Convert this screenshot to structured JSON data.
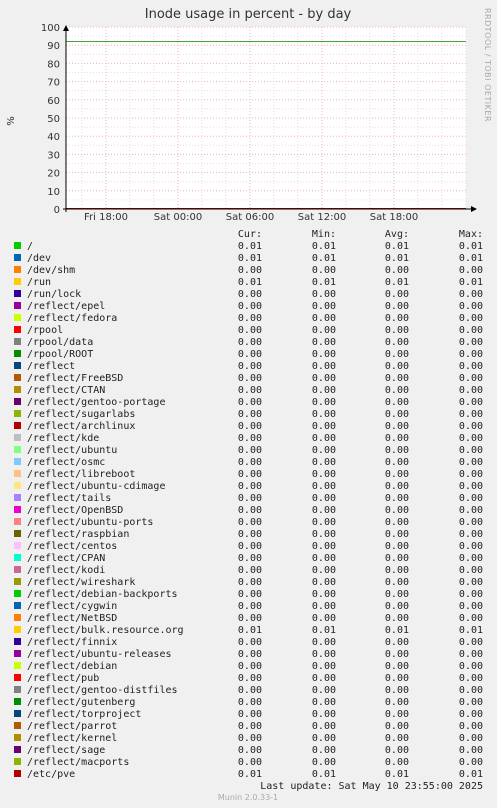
{
  "chart_data": {
    "type": "line",
    "title": "Inode usage in percent - by day",
    "ylabel": "%",
    "xlabel": "",
    "ylim": [
      0,
      100
    ],
    "y_ticks": [
      0,
      10,
      20,
      30,
      40,
      50,
      60,
      70,
      80,
      90,
      100
    ],
    "x_tick_labels": [
      "Fri 18:00",
      "Sat 00:00",
      "Sat 06:00",
      "Sat 12:00",
      "Sat 18:00"
    ],
    "threshold": {
      "value": 92,
      "color": "#4aa63a"
    },
    "grid": true,
    "legend_headers": [
      "Cur:",
      "Min:",
      "Avg:",
      "Max:"
    ],
    "series": [
      {
        "name": "/",
        "color": "#00cc00",
        "values": [
          "0.01",
          "0.01",
          "0.01",
          "0.01"
        ]
      },
      {
        "name": "/dev",
        "color": "#0066b3",
        "values": [
          "0.01",
          "0.01",
          "0.01",
          "0.01"
        ]
      },
      {
        "name": "/dev/shm",
        "color": "#ff8000",
        "values": [
          "0.00",
          "0.00",
          "0.00",
          "0.00"
        ]
      },
      {
        "name": "/run",
        "color": "#ffcc00",
        "values": [
          "0.01",
          "0.01",
          "0.01",
          "0.01"
        ]
      },
      {
        "name": "/run/lock",
        "color": "#330099",
        "values": [
          "0.00",
          "0.00",
          "0.00",
          "0.00"
        ]
      },
      {
        "name": "/reflect/epel",
        "color": "#990099",
        "values": [
          "0.00",
          "0.00",
          "0.00",
          "0.00"
        ]
      },
      {
        "name": "/reflect/fedora",
        "color": "#ccff00",
        "values": [
          "0.00",
          "0.00",
          "0.00",
          "0.00"
        ]
      },
      {
        "name": "/rpool",
        "color": "#ff0000",
        "values": [
          "0.00",
          "0.00",
          "0.00",
          "0.00"
        ]
      },
      {
        "name": "/rpool/data",
        "color": "#808080",
        "values": [
          "0.00",
          "0.00",
          "0.00",
          "0.00"
        ]
      },
      {
        "name": "/rpool/ROOT",
        "color": "#008f00",
        "values": [
          "0.00",
          "0.00",
          "0.00",
          "0.00"
        ]
      },
      {
        "name": "/reflect",
        "color": "#00487d",
        "values": [
          "0.00",
          "0.00",
          "0.00",
          "0.00"
        ]
      },
      {
        "name": "/reflect/FreeBSD",
        "color": "#b35a00",
        "values": [
          "0.00",
          "0.00",
          "0.00",
          "0.00"
        ]
      },
      {
        "name": "/reflect/CTAN",
        "color": "#b38f00",
        "values": [
          "0.00",
          "0.00",
          "0.00",
          "0.00"
        ]
      },
      {
        "name": "/reflect/gentoo-portage",
        "color": "#6b006b",
        "values": [
          "0.00",
          "0.00",
          "0.00",
          "0.00"
        ]
      },
      {
        "name": "/reflect/sugarlabs",
        "color": "#8fb300",
        "values": [
          "0.00",
          "0.00",
          "0.00",
          "0.00"
        ]
      },
      {
        "name": "/reflect/archlinux",
        "color": "#b30000",
        "values": [
          "0.00",
          "0.00",
          "0.00",
          "0.00"
        ]
      },
      {
        "name": "/reflect/kde",
        "color": "#bebebe",
        "values": [
          "0.00",
          "0.00",
          "0.00",
          "0.00"
        ]
      },
      {
        "name": "/reflect/ubuntu",
        "color": "#80ff80",
        "values": [
          "0.00",
          "0.00",
          "0.00",
          "0.00"
        ]
      },
      {
        "name": "/reflect/osmc",
        "color": "#80c9ff",
        "values": [
          "0.00",
          "0.00",
          "0.00",
          "0.00"
        ]
      },
      {
        "name": "/reflect/libreboot",
        "color": "#ffc080",
        "values": [
          "0.00",
          "0.00",
          "0.00",
          "0.00"
        ]
      },
      {
        "name": "/reflect/ubuntu-cdimage",
        "color": "#ffe680",
        "values": [
          "0.00",
          "0.00",
          "0.00",
          "0.00"
        ]
      },
      {
        "name": "/reflect/tails",
        "color": "#aa80ff",
        "values": [
          "0.00",
          "0.00",
          "0.00",
          "0.00"
        ]
      },
      {
        "name": "/reflect/OpenBSD",
        "color": "#ee00cc",
        "values": [
          "0.00",
          "0.00",
          "0.00",
          "0.00"
        ]
      },
      {
        "name": "/reflect/ubuntu-ports",
        "color": "#ff8080",
        "values": [
          "0.00",
          "0.00",
          "0.00",
          "0.00"
        ]
      },
      {
        "name": "/reflect/raspbian",
        "color": "#666600",
        "values": [
          "0.00",
          "0.00",
          "0.00",
          "0.00"
        ]
      },
      {
        "name": "/reflect/centos",
        "color": "#ffbfff",
        "values": [
          "0.00",
          "0.00",
          "0.00",
          "0.00"
        ]
      },
      {
        "name": "/reflect/CPAN",
        "color": "#00ffcc",
        "values": [
          "0.00",
          "0.00",
          "0.00",
          "0.00"
        ]
      },
      {
        "name": "/reflect/kodi",
        "color": "#cc6699",
        "values": [
          "0.00",
          "0.00",
          "0.00",
          "0.00"
        ]
      },
      {
        "name": "/reflect/wireshark",
        "color": "#999900",
        "values": [
          "0.00",
          "0.00",
          "0.00",
          "0.00"
        ]
      },
      {
        "name": "/reflect/debian-backports",
        "color": "#00cc00",
        "values": [
          "0.00",
          "0.00",
          "0.00",
          "0.00"
        ]
      },
      {
        "name": "/reflect/cygwin",
        "color": "#0066b3",
        "values": [
          "0.00",
          "0.00",
          "0.00",
          "0.00"
        ]
      },
      {
        "name": "/reflect/NetBSD",
        "color": "#ff8000",
        "values": [
          "0.00",
          "0.00",
          "0.00",
          "0.00"
        ]
      },
      {
        "name": "/reflect/bulk.resource.org",
        "color": "#ffcc00",
        "values": [
          "0.01",
          "0.01",
          "0.01",
          "0.01"
        ]
      },
      {
        "name": "/reflect/finnix",
        "color": "#330099",
        "values": [
          "0.00",
          "0.00",
          "0.00",
          "0.00"
        ]
      },
      {
        "name": "/reflect/ubuntu-releases",
        "color": "#990099",
        "values": [
          "0.00",
          "0.00",
          "0.00",
          "0.00"
        ]
      },
      {
        "name": "/reflect/debian",
        "color": "#ccff00",
        "values": [
          "0.00",
          "0.00",
          "0.00",
          "0.00"
        ]
      },
      {
        "name": "/reflect/pub",
        "color": "#ff0000",
        "values": [
          "0.00",
          "0.00",
          "0.00",
          "0.00"
        ]
      },
      {
        "name": "/reflect/gentoo-distfiles",
        "color": "#808080",
        "values": [
          "0.00",
          "0.00",
          "0.00",
          "0.00"
        ]
      },
      {
        "name": "/reflect/gutenberg",
        "color": "#008f00",
        "values": [
          "0.00",
          "0.00",
          "0.00",
          "0.00"
        ]
      },
      {
        "name": "/reflect/torproject",
        "color": "#00487d",
        "values": [
          "0.00",
          "0.00",
          "0.00",
          "0.00"
        ]
      },
      {
        "name": "/reflect/parrot",
        "color": "#b35a00",
        "values": [
          "0.00",
          "0.00",
          "0.00",
          "0.00"
        ]
      },
      {
        "name": "/reflect/kernel",
        "color": "#b38f00",
        "values": [
          "0.00",
          "0.00",
          "0.00",
          "0.00"
        ]
      },
      {
        "name": "/reflect/sage",
        "color": "#6b006b",
        "values": [
          "0.00",
          "0.00",
          "0.00",
          "0.00"
        ]
      },
      {
        "name": "/reflect/macports",
        "color": "#8fb300",
        "values": [
          "0.00",
          "0.00",
          "0.00",
          "0.00"
        ]
      },
      {
        "name": "/etc/pve",
        "color": "#b30000",
        "values": [
          "0.01",
          "0.01",
          "0.01",
          "0.01"
        ]
      }
    ]
  },
  "sidebar_text": "RRDTOOL / TOBI OETIKER",
  "footer": {
    "last_update": "Last update:  Sat May 10 23:55:00 2025",
    "version": "Munin 2.0.33-1"
  }
}
